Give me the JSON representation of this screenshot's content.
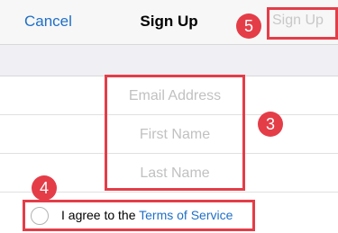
{
  "navbar": {
    "cancel_label": "Cancel",
    "title": "Sign Up",
    "signup_label": "Sign Up"
  },
  "form": {
    "email_placeholder": "Email Address",
    "first_name_placeholder": "First Name",
    "last_name_placeholder": "Last Name"
  },
  "agreement": {
    "prefix": "I agree to the ",
    "link_text": "Terms of Service",
    "checked": false
  },
  "annotations": {
    "badge_signup": "5",
    "badge_fields": "3",
    "badge_agreement": "4"
  },
  "colors": {
    "accent": "#1f6fc7",
    "highlight": "#e43d48",
    "disabled": "#c8c8c8",
    "placeholder": "#c1c1c1",
    "background": "#efeff4"
  }
}
